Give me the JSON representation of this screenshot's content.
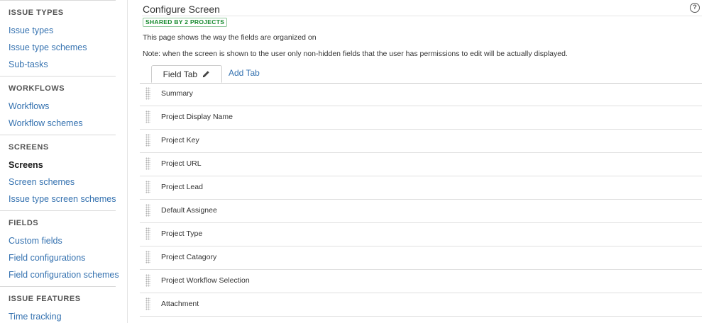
{
  "sidebar": {
    "sections": [
      {
        "header": "ISSUE TYPES",
        "items": [
          {
            "label": "Issue types",
            "active": false
          },
          {
            "label": "Issue type schemes",
            "active": false
          },
          {
            "label": "Sub-tasks",
            "active": false
          }
        ]
      },
      {
        "header": "WORKFLOWS",
        "items": [
          {
            "label": "Workflows",
            "active": false
          },
          {
            "label": "Workflow schemes",
            "active": false
          }
        ]
      },
      {
        "header": "SCREENS",
        "items": [
          {
            "label": "Screens",
            "active": true
          },
          {
            "label": "Screen schemes",
            "active": false
          },
          {
            "label": "Issue type screen schemes",
            "active": false
          }
        ]
      },
      {
        "header": "FIELDS",
        "items": [
          {
            "label": "Custom fields",
            "active": false
          },
          {
            "label": "Field configurations",
            "active": false
          },
          {
            "label": "Field configuration schemes",
            "active": false
          }
        ]
      },
      {
        "header": "ISSUE FEATURES",
        "items": [
          {
            "label": "Time tracking",
            "active": false
          }
        ]
      }
    ]
  },
  "main": {
    "title": "Configure Screen",
    "help_icon": "question-circle-icon",
    "shared_badge": "SHARED BY 2 PROJECTS",
    "description": "This page shows the way the fields are organized on",
    "note": "Note: when the screen is shown to the user only non-hidden fields that the user has permissions to edit will be actually displayed.",
    "tabs": {
      "field_tab": "Field Tab",
      "edit_icon": "pencil-icon",
      "add_tab": "Add Tab"
    },
    "fields": [
      "Summary",
      "Project Display Name",
      "Project Key",
      "Project URL",
      "Project Lead",
      "Default Assignee",
      "Project Type",
      "Project Catagory",
      "Project Workflow Selection",
      "Attachment"
    ]
  },
  "colors": {
    "link": "#3572b0",
    "badge_green": "#14892c",
    "border": "#cccccc"
  }
}
